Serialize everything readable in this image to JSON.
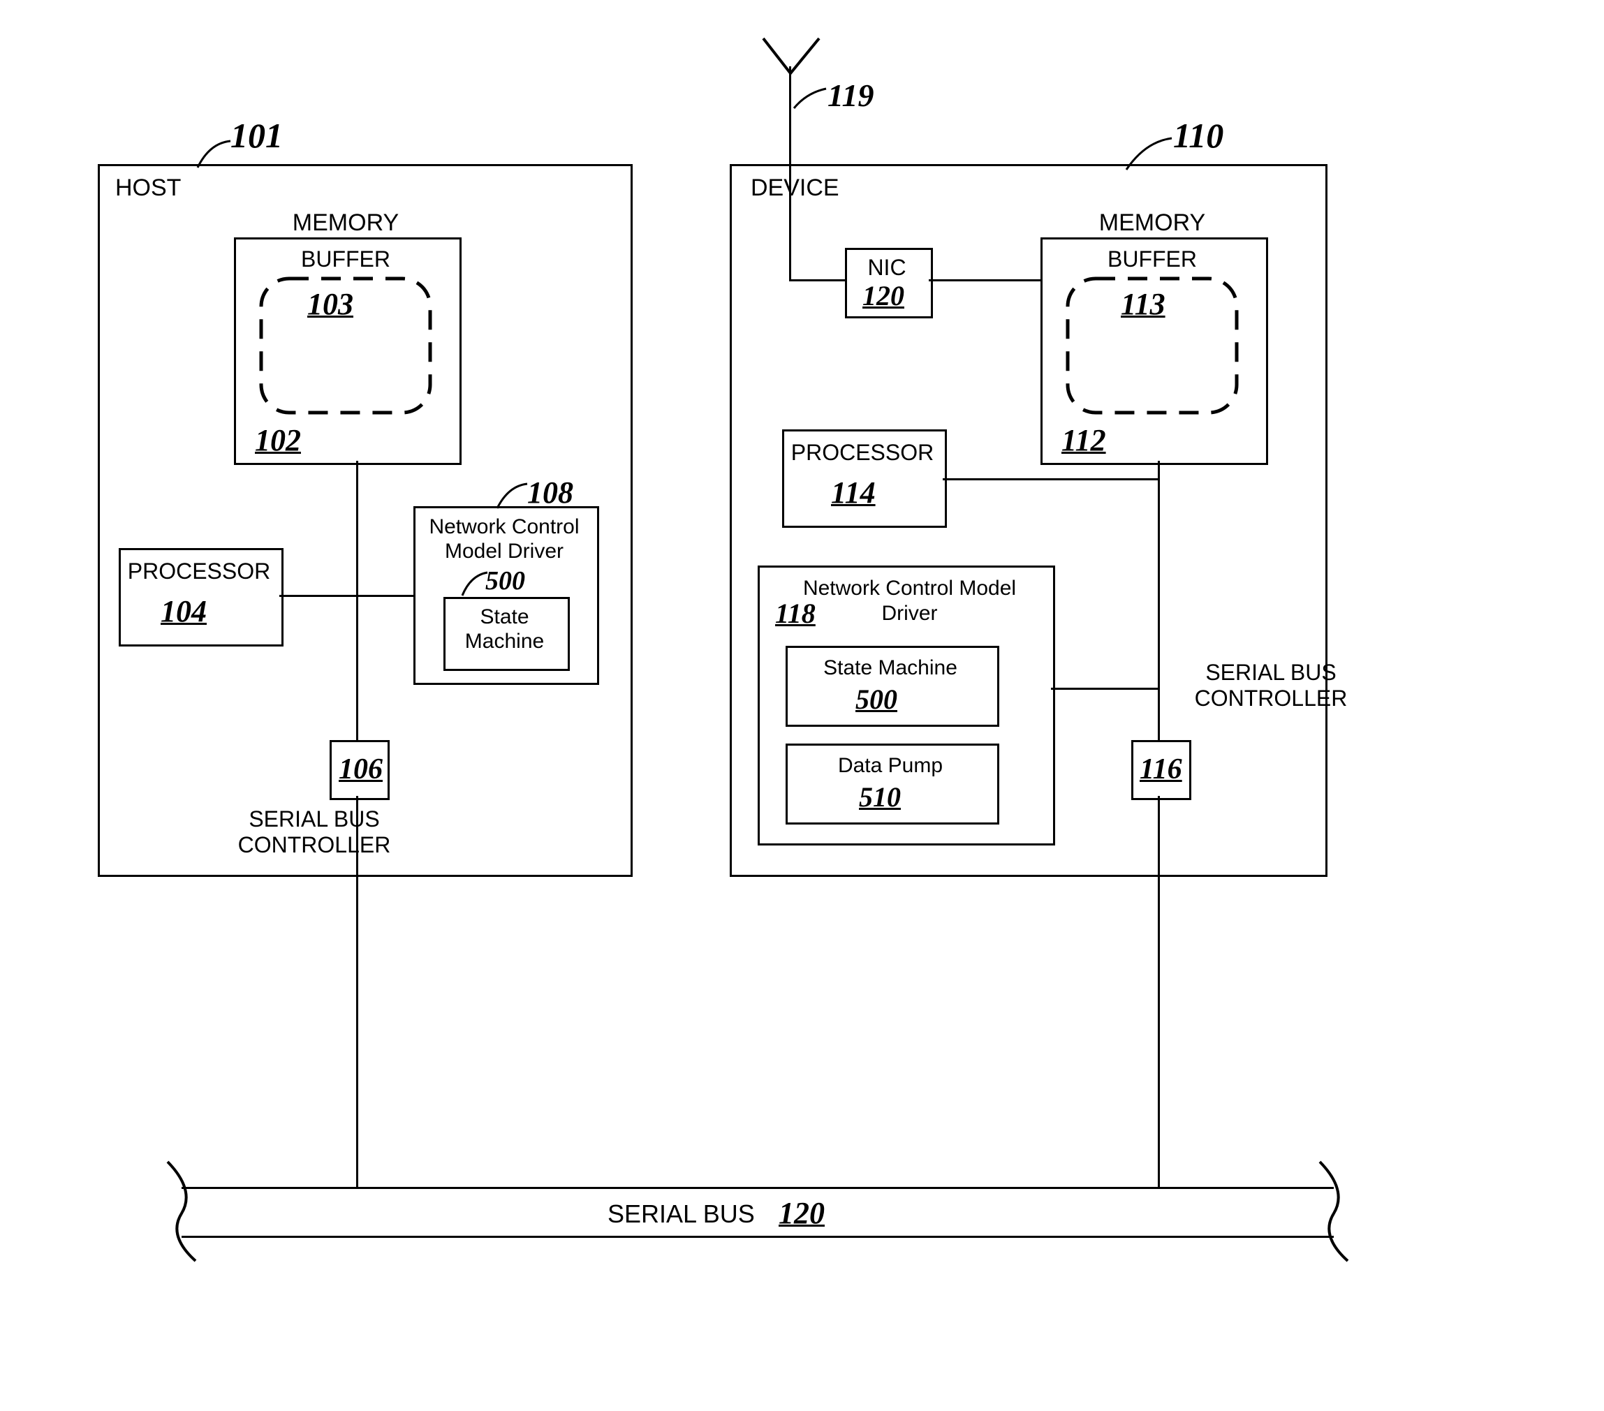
{
  "host": {
    "title": "HOST",
    "ref": "101",
    "memory": {
      "title": "MEMORY",
      "ref": "102",
      "buffer": {
        "title": "BUFFER",
        "ref": "103"
      }
    },
    "processor": {
      "title": "PROCESSOR",
      "ref": "104"
    },
    "driver": {
      "title": "Network Control\nModel Driver",
      "ref": "108",
      "stateMachine": {
        "title": "State\nMachine",
        "ref": "500"
      }
    },
    "controller": {
      "title": "SERIAL BUS\nCONTROLLER",
      "ref": "106"
    }
  },
  "device": {
    "title": "DEVICE",
    "ref": "110",
    "antennaRef": "119",
    "nic": {
      "title": "NIC",
      "ref": "120"
    },
    "memory": {
      "title": "MEMORY",
      "ref": "112",
      "buffer": {
        "title": "BUFFER",
        "ref": "113"
      }
    },
    "processor": {
      "title": "PROCESSOR",
      "ref": "114"
    },
    "driver": {
      "title": "Network Control Model\nDriver",
      "ref": "118",
      "stateMachine": {
        "title": "State Machine",
        "ref": "500"
      },
      "dataPump": {
        "title": "Data Pump",
        "ref": "510"
      }
    },
    "controller": {
      "title": "SERIAL BUS\nCONTROLLER",
      "ref": "116"
    }
  },
  "bus": {
    "title": "SERIAL BUS",
    "ref": "120"
  }
}
